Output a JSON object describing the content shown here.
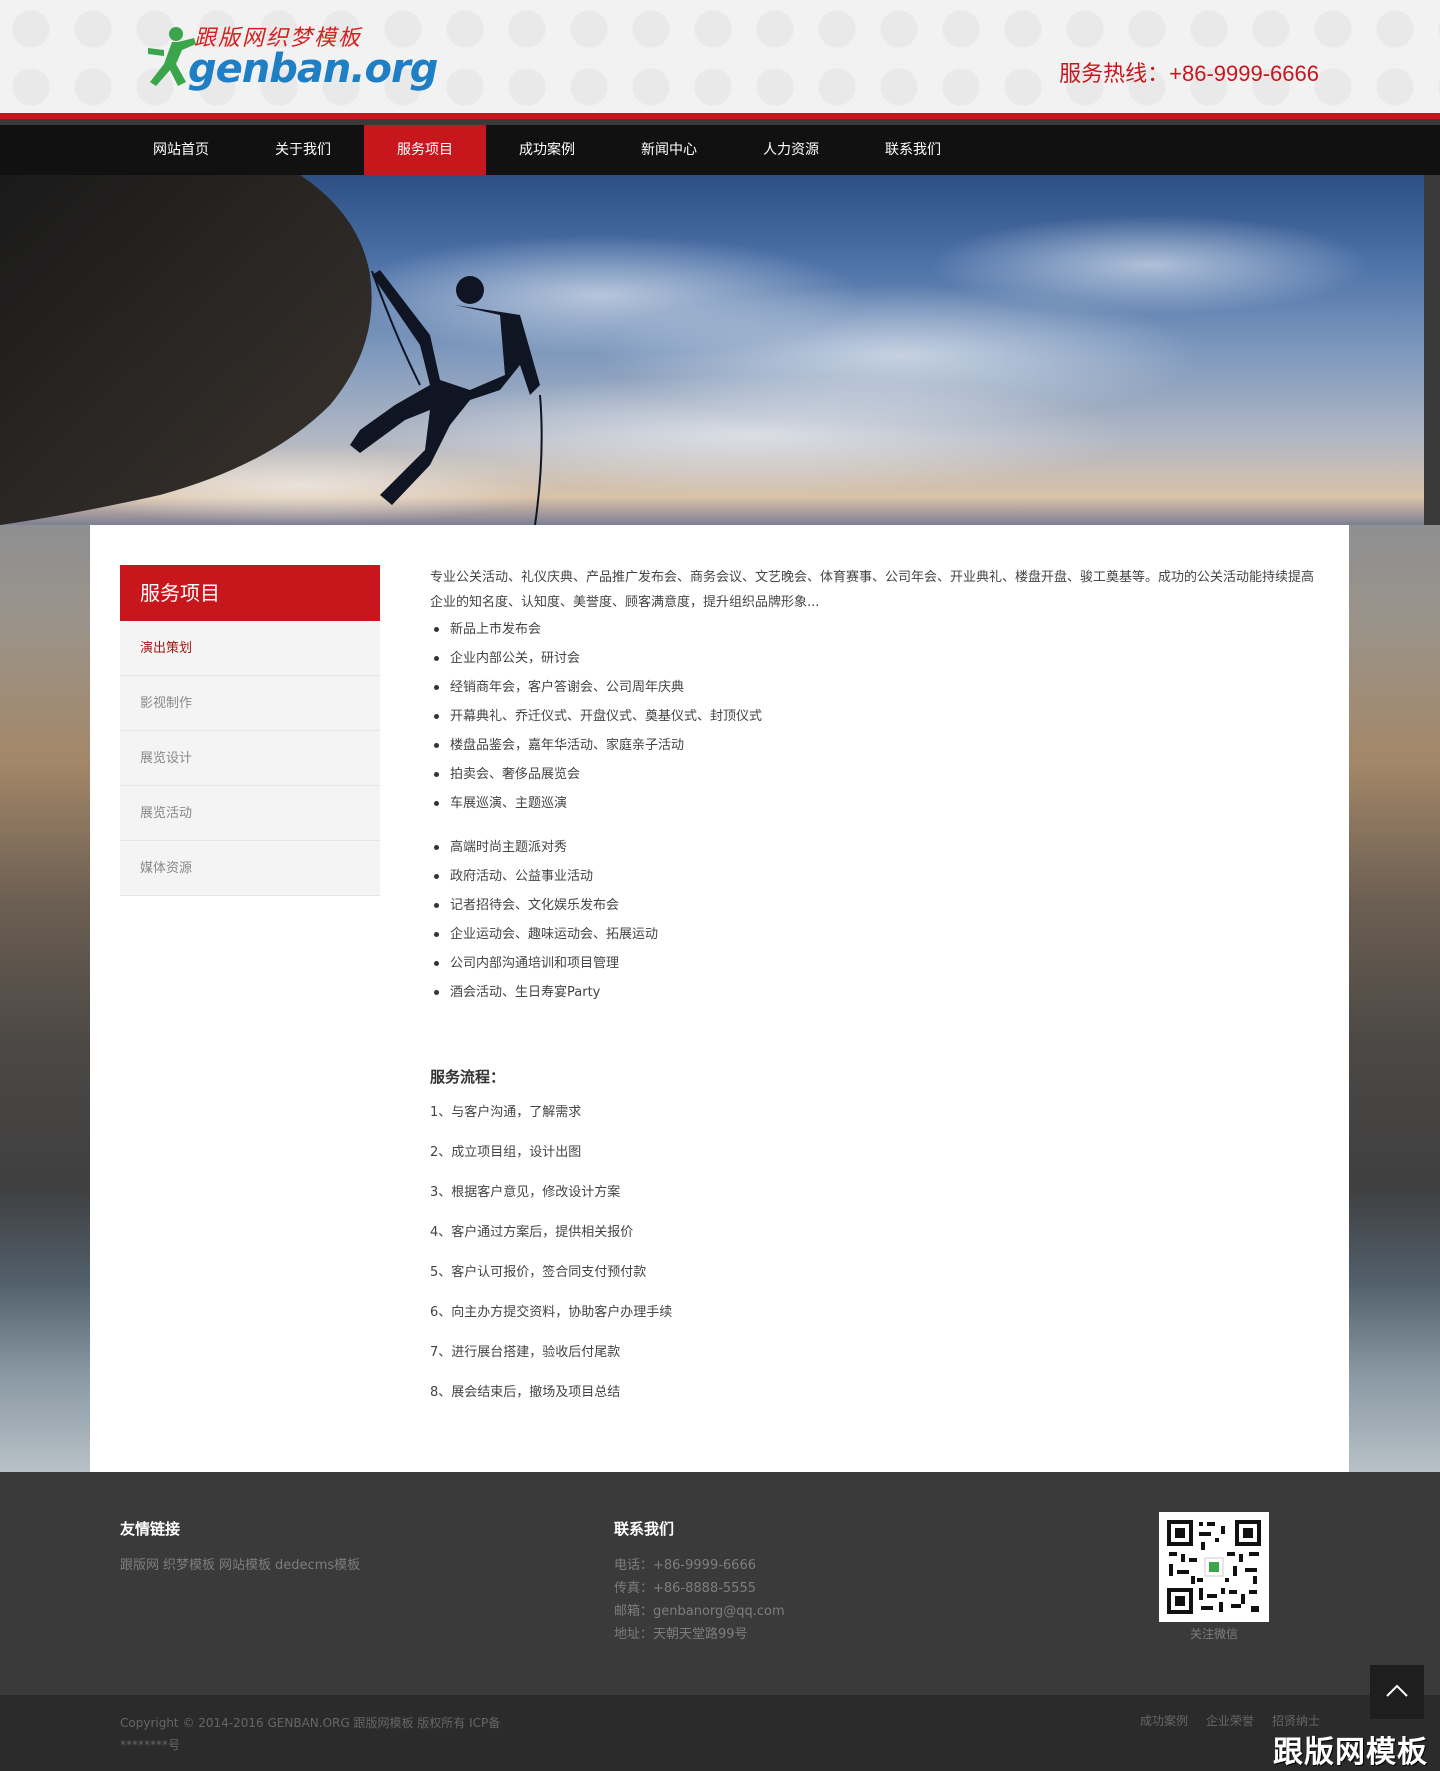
{
  "header": {
    "logo_title": "跟版网织梦模板",
    "logo_word": "genban.org",
    "hotline": "服务热线：+86-9999-6666"
  },
  "nav": {
    "items": [
      {
        "label": "网站首页",
        "active": false
      },
      {
        "label": "关于我们",
        "active": false
      },
      {
        "label": "服务项目",
        "active": true
      },
      {
        "label": "成功案例",
        "active": false
      },
      {
        "label": "新闻中心",
        "active": false
      },
      {
        "label": "人力资源",
        "active": false
      },
      {
        "label": "联系我们",
        "active": false
      }
    ]
  },
  "sidebar": {
    "title": "服务项目",
    "items": [
      {
        "label": "演出策划",
        "active": true
      },
      {
        "label": "影视制作",
        "active": false
      },
      {
        "label": "展览设计",
        "active": false
      },
      {
        "label": "展览活动",
        "active": false
      },
      {
        "label": "媒体资源",
        "active": false
      }
    ]
  },
  "main": {
    "intro": " 专业公关活动、礼仪庆典、产品推广发布会、商务会议、文艺晚会、体育赛事、公司年会、开业典礼、楼盘开盘、骏工奠基等。成功的公关活动能持续提高企业的知名度、认知度、美誉度、顾客满意度，提升组织品牌形象...",
    "list1": [
      "新品上市发布会",
      "企业内部公关，研讨会",
      "经销商年会，客户答谢会、公司周年庆典",
      "开幕典礼、乔迁仪式、开盘仪式、奠基仪式、封顶仪式",
      "楼盘品鉴会，嘉年华活动、家庭亲子活动",
      "拍卖会、奢侈品展览会",
      "车展巡演、主题巡演"
    ],
    "list2": [
      "高端时尚主题派对秀",
      "政府活动、公益事业活动",
      "记者招待会、文化娱乐发布会",
      "企业运动会、趣味运动会、拓展运动",
      "公司内部沟通培训和项目管理",
      "酒会活动、生日寿宴Party"
    ],
    "flow_title": "服务流程：",
    "steps": [
      "1、与客户沟通，了解需求",
      "2、成立项目组，设计出图",
      "3、根据客户意见，修改设计方案",
      "4、客户通过方案后，提供相关报价",
      "5、客户认可报价，签合同支付预付款",
      "6、向主办方提交资料，协助客户办理手续",
      "7、进行展台搭建，验收后付尾款",
      "8、展会结束后，撤场及项目总结"
    ]
  },
  "footer": {
    "links_title": "友情链接",
    "links": [
      "跟版网",
      "织梦模板",
      "网站模板",
      "dedecms模板"
    ],
    "contact_title": "联系我们",
    "contact": [
      "电话：+86-9999-6666",
      "传真：+86-8888-5555",
      "邮箱：genbanorg@qq.com",
      "地址：天朝天堂路99号"
    ],
    "qr_label": "关注微信",
    "copyright_line1": "Copyright © 2014-2016 GENBAN.ORG 跟版网模板 版权所有   ICP备",
    "copyright_line2": "********号",
    "bottom_links": [
      "成功案例",
      "企业荣誉",
      "招贤纳士"
    ],
    "watermark": "跟版网模板"
  },
  "colors": {
    "brand_red": "#c8161d",
    "nav_bg": "#111111",
    "footer_bg": "#3a3a3a"
  }
}
